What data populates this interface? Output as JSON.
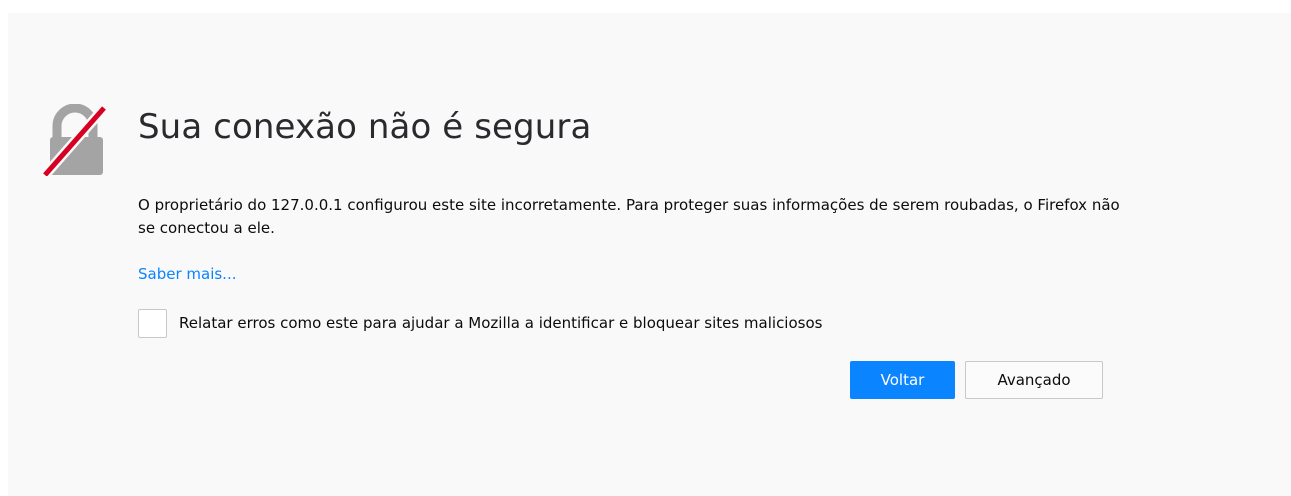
{
  "error_page": {
    "title": "Sua conexão não é segura",
    "description": "O proprietário do 127.0.0.1 configurou este site incorretamente. Para proteger suas informações de serem roubadas, o Firefox não se conectou a ele.",
    "learn_more_link": "Saber mais...",
    "report_checkbox": {
      "label": "Relatar erros como este para ajudar a Mozilla a identificar e bloquear sites maliciosos",
      "checked": false
    },
    "buttons": {
      "back": "Voltar",
      "advanced": "Avançado"
    },
    "icon": "broken-lock-icon"
  },
  "colors": {
    "background": "#f9f9fa",
    "link": "#0a84ff",
    "primary_button": "#0a84ff",
    "icon_gray": "#a4a4a4",
    "icon_slash": "#d70022"
  }
}
